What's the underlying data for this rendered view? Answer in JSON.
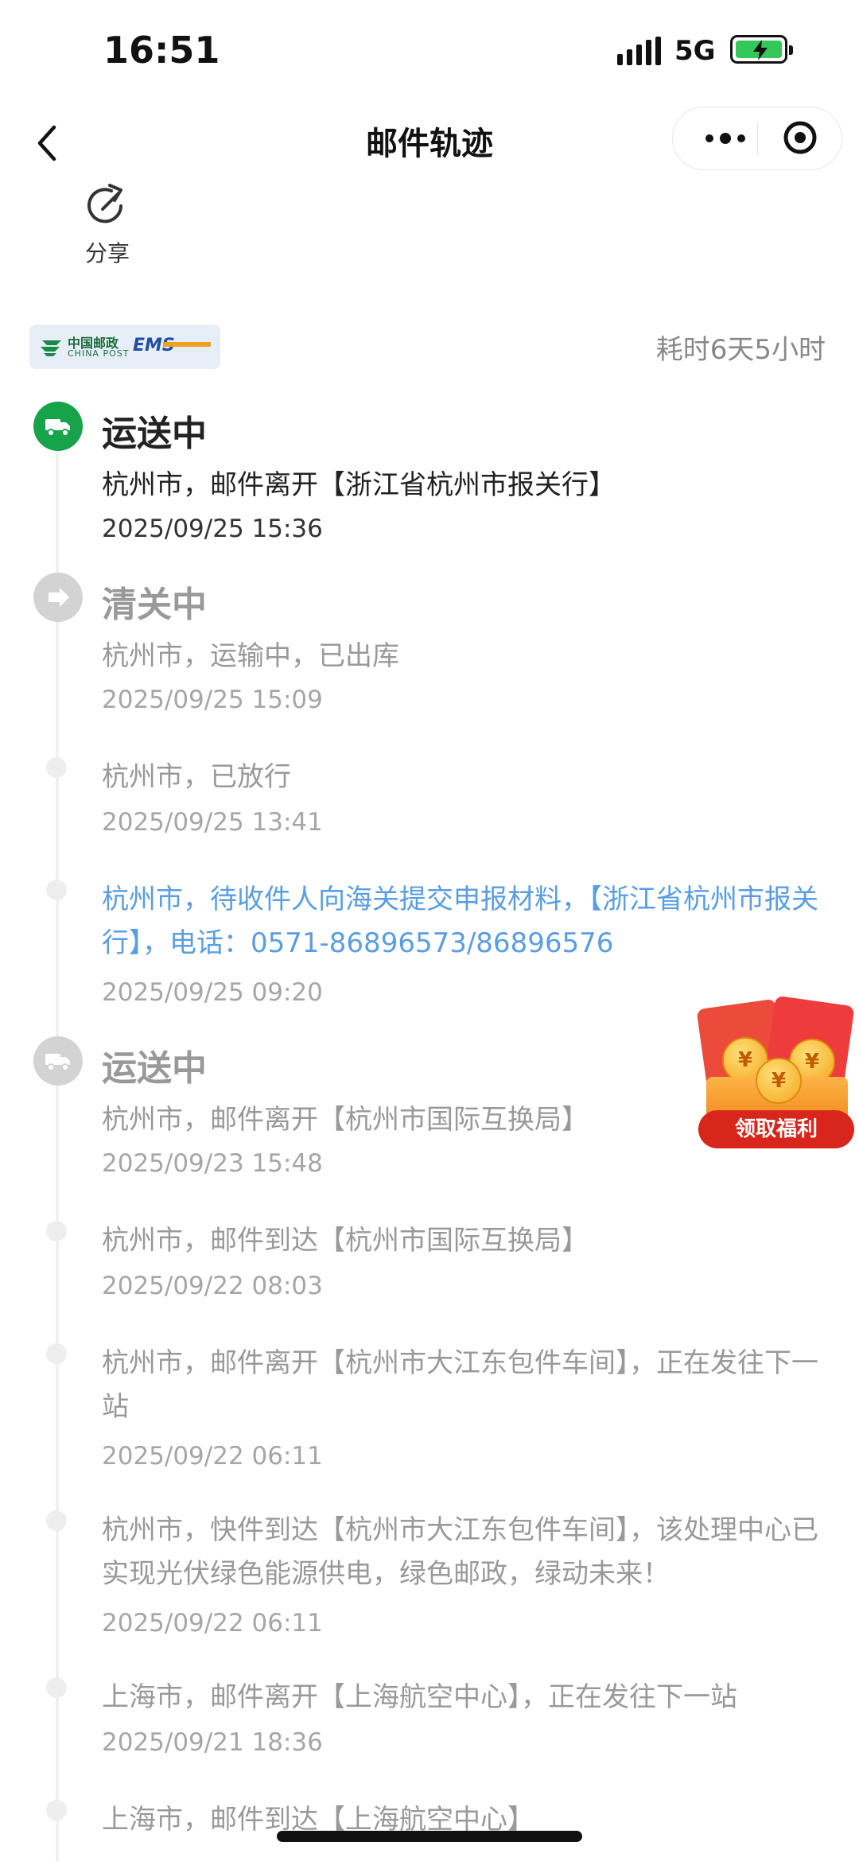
{
  "status_bar": {
    "time": "16:51",
    "network": "5G"
  },
  "nav": {
    "title": "邮件轨迹"
  },
  "share": {
    "label": "分享"
  },
  "carrier": {
    "logo_cn": "中国邮政",
    "logo_en": "CHINA POST",
    "logo_ems": "EMS"
  },
  "duration": "耗时6天5小时",
  "events": [
    {
      "status": "运送中",
      "desc": "杭州市，邮件离开【浙江省杭州市报关行】",
      "time": "2025/09/25 15:36"
    },
    {
      "status": "清关中",
      "desc": "杭州市，运输中，已出库",
      "time": "2025/09/25 15:09"
    },
    {
      "desc": "杭州市，已放行",
      "time": "2025/09/25 13:41"
    },
    {
      "desc": "杭州市，待收件人向海关提交申报材料，【浙江省杭州市报关行】，电话：0571-86896573/86896576",
      "time": "2025/09/25 09:20"
    },
    {
      "status": "运送中",
      "desc": "杭州市，邮件离开【杭州市国际互换局】",
      "time": "2025/09/23 15:48"
    },
    {
      "desc": "杭州市，邮件到达【杭州市国际互换局】",
      "time": "2025/09/22 08:03"
    },
    {
      "desc": "杭州市，邮件离开【杭州市大江东包件车间】，正在发往下一站",
      "time": "2025/09/22 06:11"
    },
    {
      "desc": "杭州市，快件到达【杭州市大江东包件车间】，该处理中心已实现光伏绿色能源供电，绿色邮政，绿动未来！",
      "time": "2025/09/22 06:11"
    },
    {
      "desc": "上海市，邮件离开【上海航空中心】，正在发往下一站",
      "time": "2025/09/21 18:36"
    },
    {
      "desc": "上海市，邮件到达【上海航空中心】"
    }
  ],
  "promo": {
    "label": "领取福利",
    "coin_symbol": "¥"
  }
}
